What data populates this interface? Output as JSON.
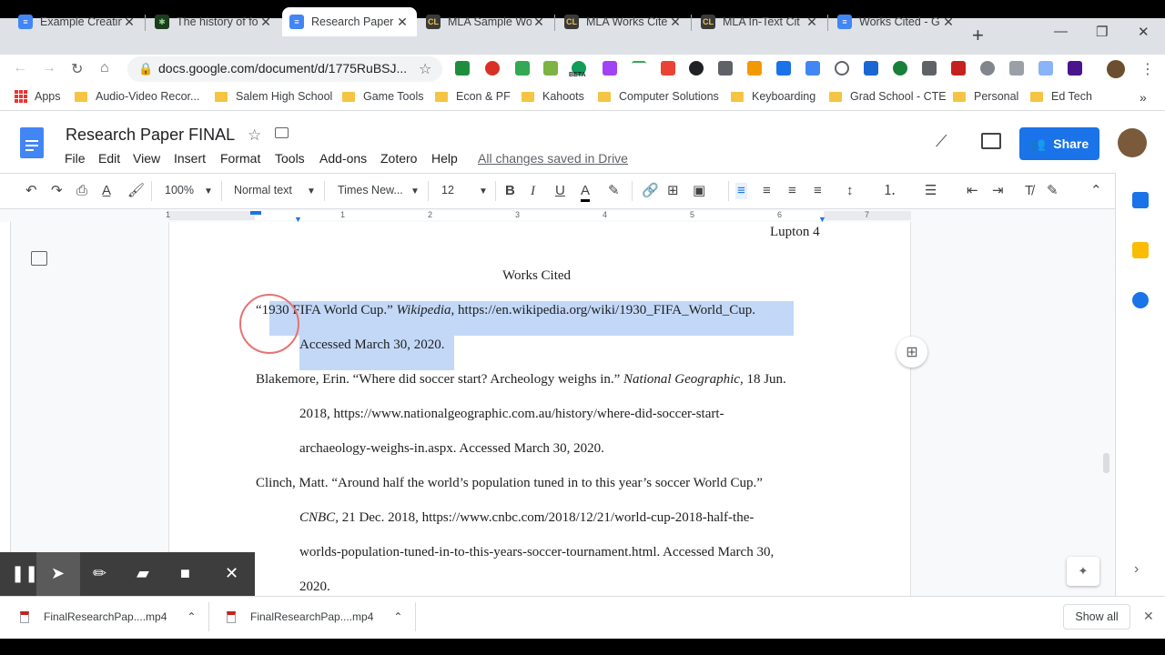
{
  "browser": {
    "tabs": [
      {
        "title": "Example Creatin",
        "icon": "docs-icon",
        "active": false
      },
      {
        "title": "The history of fo",
        "icon": "history-site-icon",
        "active": false
      },
      {
        "title": "Research Paper",
        "icon": "docs-icon",
        "active": true
      },
      {
        "title": "MLA Sample Wo",
        "icon": "mla-icon",
        "active": false
      },
      {
        "title": "MLA Works Cite",
        "icon": "mla-icon",
        "active": false
      },
      {
        "title": "MLA In-Text Cit",
        "icon": "mla-icon",
        "active": false
      },
      {
        "title": "Works Cited - G",
        "icon": "docs-icon",
        "active": false
      }
    ],
    "url": "docs.google.com/document/d/1775RuBSJ...",
    "ext_beta_label": "BETA",
    "bookmarks": {
      "apps": "Apps",
      "items": [
        "Audio-Video Recor...",
        "Salem High School",
        "Game Tools",
        "Econ & PF",
        "Kahoots",
        "Computer Solutions",
        "Keyboarding",
        "Grad School - CTE",
        "Personal",
        "Ed Tech"
      ],
      "more": "»"
    }
  },
  "doc": {
    "title": "Research Paper FINAL",
    "menu": [
      "File",
      "Edit",
      "View",
      "Insert",
      "Format",
      "Tools",
      "Add-ons",
      "Zotero",
      "Help"
    ],
    "save_status": "All changes saved in Drive",
    "share_label": "Share"
  },
  "toolbar": {
    "zoom": "100%",
    "style": "Normal text",
    "font": "Times New...",
    "size": "12"
  },
  "ruler": [
    "1",
    "1",
    "2",
    "3",
    "4",
    "5",
    "6",
    "7"
  ],
  "page": {
    "header": "Lupton 4",
    "heading": "Works Cited",
    "lines": {
      "l1a": "“1930 FIFA World Cup.” ",
      "l1b": "Wikipedia",
      "l1c": ", https://en.wikipedia.org/wiki/1930_FIFA_World_Cup.",
      "l2": "Accessed March 30, 2020.",
      "l3a": "Blakemore, Erin. “Where did soccer start? Archeology weighs in.” ",
      "l3b": "National Geographic",
      "l3c": ", 18 Jun.",
      "l4": "2018, https://www.nationalgeographic.com.au/history/where-did-soccer-start-",
      "l5": "archaeology-weighs-in.aspx. Accessed March 30, 2020.",
      "l6": "Clinch, Matt. “Around half the world’s population tuned in to this year’s soccer World Cup.”",
      "l7a": "CNBC",
      "l7b": ", 21 Dec. 2018, https://www.cnbc.com/2018/12/21/world-cup-2018-half-the-",
      "l8": "worlds-population-tuned-in-to-this-years-soccer-tournament.html. Accessed March 30,",
      "l9": "2020."
    }
  },
  "downloads": {
    "items": [
      "FinalResearchPap....mp4",
      "FinalResearchPap....mp4"
    ],
    "show_all": "Show all"
  },
  "colors": {
    "accent": "#1a73e8",
    "selection": "#c3d8f7",
    "cursor_ring": "#e57373"
  }
}
